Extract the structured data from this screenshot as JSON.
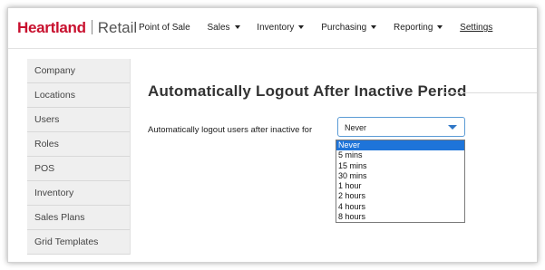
{
  "brand": {
    "name": "Heartland",
    "product": "Retail"
  },
  "nav": {
    "items": [
      {
        "label": "Point of Sale",
        "caret": false
      },
      {
        "label": "Sales",
        "caret": true
      },
      {
        "label": "Inventory",
        "caret": true
      },
      {
        "label": "Purchasing",
        "caret": true
      },
      {
        "label": "Reporting",
        "caret": true
      }
    ],
    "settings": "Settings"
  },
  "sidebar": {
    "items": [
      "Company",
      "Locations",
      "Users",
      "Roles",
      "POS",
      "Inventory",
      "Sales Plans",
      "Grid Templates"
    ]
  },
  "main": {
    "title": "Automatically Logout After Inactive Period",
    "field_label": "Automatically logout users after inactive for",
    "select": {
      "value": "Never",
      "options": [
        "Never",
        "5 mins",
        "15 mins",
        "30 mins",
        "1 hour",
        "2 hours",
        "4 hours",
        "8 hours"
      ]
    }
  },
  "colors": {
    "brand_red": "#c8102e",
    "accent_blue": "#1e74d9",
    "select_border": "#5b9bd5"
  }
}
